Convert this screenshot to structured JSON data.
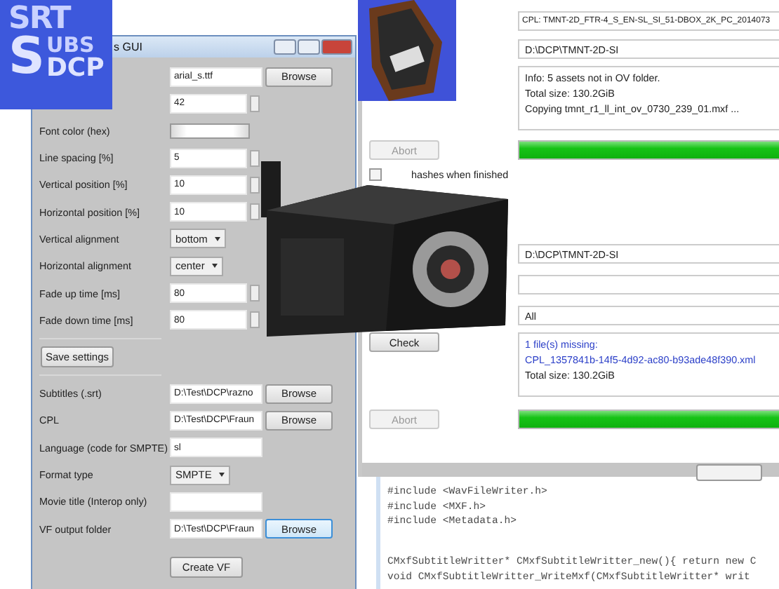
{
  "logo": {
    "line_1": "SRT",
    "initial": "S",
    "line_2": "UBS",
    "line_3": "DCP"
  },
  "settings_window": {
    "title": "s GUI",
    "settings": [
      {
        "kind": "file",
        "value": "arial_s.ttf",
        "button": "Browse"
      },
      {
        "kind": "spin",
        "value": "42"
      },
      {
        "kind": "color",
        "label": "Font color (hex)"
      },
      {
        "kind": "spin",
        "label": "Line spacing [%]",
        "value": "5"
      },
      {
        "kind": "spin",
        "label": "Vertical position [%]",
        "value": "10"
      },
      {
        "kind": "spin",
        "label": "Horizontal position [%]",
        "value": "10"
      },
      {
        "kind": "select",
        "label": "Vertical alignment",
        "value": "bottom"
      },
      {
        "kind": "select",
        "label": "Horizontal alignment",
        "value": "center"
      },
      {
        "kind": "spin",
        "label": "Fade up time [ms]",
        "value": "80"
      },
      {
        "kind": "spin",
        "label": "Fade down time [ms]",
        "value": "80"
      }
    ],
    "save_button": "Save settings",
    "outputs": [
      {
        "kind": "file",
        "label": "Subtitles (.srt)",
        "value": "D:\\Test\\DCP\\razno",
        "button": "Browse",
        "focused": false
      },
      {
        "kind": "file",
        "label": "CPL",
        "value": "D:\\Test\\DCP\\Fraun",
        "button": "Browse",
        "focused": false
      },
      {
        "kind": "text",
        "label": "Language (code for SMPTE)",
        "value": "sl"
      },
      {
        "kind": "select",
        "label": "Format type",
        "value": "SMPTE"
      },
      {
        "kind": "text",
        "label": "Movie title (Interop only)"
      },
      {
        "kind": "file",
        "label": "VF output folder",
        "value": "D:\\Test\\DCP\\Fraun",
        "button": "Browse",
        "focused": true
      }
    ],
    "create_button": "Create VF"
  },
  "copy_window": {
    "copy": {
      "cpl": "CPL: TMNT-2D_FTR-4_S_EN-SL_SI_51-DBOX_2K_PC_2014073",
      "folder": "D:\\DCP\\TMNT-2D-SI",
      "log": [
        {
          "text": "Info: 5 assets not in OV folder.",
          "color": "#222222"
        },
        {
          "text": "Total size: 130.2GiB",
          "color": "#222222"
        },
        {
          "text": "Copying tmnt_r1_ll_int_ov_0730_239_01.mxf ...",
          "color": "#222222"
        }
      ],
      "abort": {
        "label": "Abort",
        "disabled": true
      },
      "level": 1,
      "checkbox": {
        "label": "hashes when finished",
        "checked": false
      }
    },
    "check": {
      "folder": "D:\\DCP\\TMNT-2D-SI",
      "filter": "All",
      "button": "Check",
      "log": [
        {
          "text": "1 file(s) missing:",
          "color": "#2b3fc8"
        },
        {
          "text": "CPL_1357841b-14f5-4d92-ac80-b93ade48f390.xml",
          "color": "#2b3fc8"
        },
        {
          "text": "Total size: 130.2GiB",
          "color": "#222222"
        }
      ],
      "abort": {
        "label": "Abort",
        "disabled": true
      },
      "level": 1
    }
  },
  "code_window": {
    "blocks": [
      [
        "#include <WavFileWriter.h>",
        "#include <MXF.h>",
        "#include <Metadata.h>"
      ],
      [
        "CMxfSubtitleWritter* CMxfSubtitleWritter_new(){ return new C",
        "void CMxfSubtitleWritter_WriteMxf(CMxfSubtitleWritter* writ"
      ]
    ]
  }
}
